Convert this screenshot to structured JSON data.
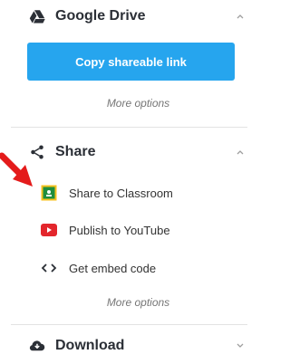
{
  "google_drive": {
    "title": "Google Drive",
    "primary_button": "Copy shareable link",
    "more_options": "More options"
  },
  "share": {
    "title": "Share",
    "items": [
      {
        "label": "Share to Classroom",
        "icon": "classroom-icon"
      },
      {
        "label": "Publish to YouTube",
        "icon": "youtube-icon"
      },
      {
        "label": "Get embed code",
        "icon": "code-icon"
      }
    ],
    "more_options": "More options"
  },
  "download": {
    "title": "Download"
  },
  "colors": {
    "button": "#26a5ee",
    "arrow": "#e41b1b",
    "youtube": "#e3262c",
    "classroom": "#1e8e3e",
    "classroom_border": "#f6c21f"
  }
}
